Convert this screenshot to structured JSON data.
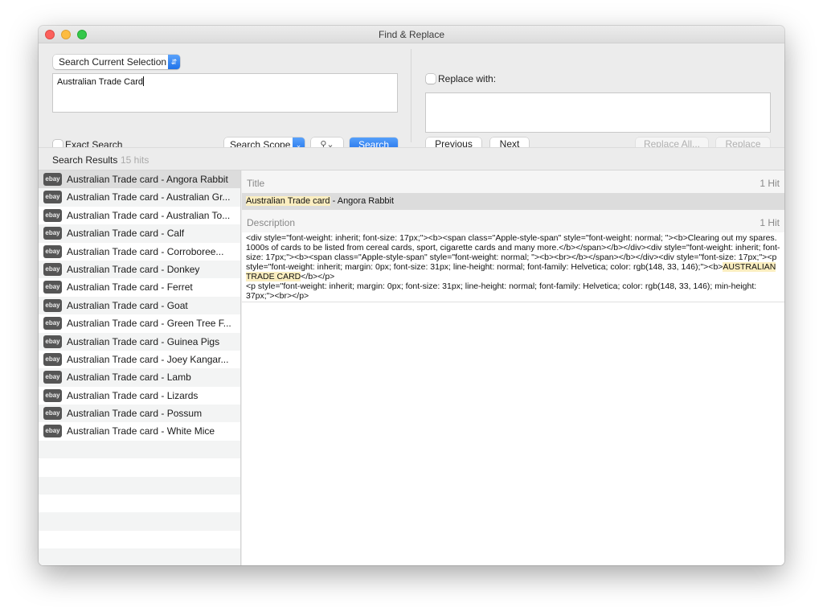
{
  "window": {
    "title": "Find & Replace"
  },
  "search": {
    "scope_select": "Search Current Selection",
    "query": "Australian Trade Card",
    "exact_search_label": "Exact Search",
    "exact_search_checked": false,
    "search_scope_label": "Search Scope",
    "search_options_icon": "magnifier-dropdown",
    "search_button": "Search"
  },
  "replace": {
    "checkbox_label": "Replace with:",
    "checked": false,
    "value": "",
    "previous_button": "Previous",
    "next_button": "Next",
    "replace_all_button": "Replace All...",
    "replace_button": "Replace"
  },
  "results": {
    "title": "Search Results",
    "count": "15 hits",
    "badge": "ebay",
    "items": [
      {
        "label": "Australian Trade card - Angora Rabbit"
      },
      {
        "label": "Australian Trade card - Australian Gr..."
      },
      {
        "label": "Australian Trade card - Australian To..."
      },
      {
        "label": "Australian Trade card - Calf"
      },
      {
        "label": "Australian Trade card - Corroboree..."
      },
      {
        "label": "Australian Trade card - Donkey"
      },
      {
        "label": "Australian Trade card - Ferret"
      },
      {
        "label": "Australian Trade card - Goat"
      },
      {
        "label": "Australian Trade card - Green Tree F..."
      },
      {
        "label": "Australian Trade card - Guinea Pigs"
      },
      {
        "label": "Australian Trade card - Joey Kangar..."
      },
      {
        "label": "Australian Trade card - Lamb"
      },
      {
        "label": "Australian Trade card - Lizards"
      },
      {
        "label": "Australian Trade card - Possum"
      },
      {
        "label": "Australian Trade card - White Mice"
      }
    ]
  },
  "detail": {
    "title_section": {
      "label": "Title",
      "hits": "1 Hit",
      "highlight": "Australian Trade card",
      "rest": " - Angora Rabbit"
    },
    "description_section": {
      "label": "Description",
      "hits": "1 Hit",
      "text_before": "<div style=\"font-weight: inherit; font-size: 17px;\"><b><span class=\"Apple-style-span\" style=\"font-weight: normal; \"><b>Clearing out my spares. 1000s of cards to be listed from cereal cards, sport, cigarette cards and many more.</b></span></b></div><div style=\"font-weight: inherit; font-size: 17px;\"><b><span class=\"Apple-style-span\" style=\"font-weight: normal; \"><b><br></b></span></b></div><div style=\"font-size: 17px;\"><p style=\"font-weight: inherit; margin: 0px; font-size: 31px; line-height: normal; font-family: Helvetica; color: rgb(148, 33, 146);\"><b>",
      "highlight": "AUSTRALIAN TRADE CARD",
      "text_after": "</b></p>",
      "text_line2": "<p style=\"font-weight: inherit; margin: 0px; font-size: 31px; line-height: normal; font-family: Helvetica; color: rgb(148, 33, 146); min-height: 37px;\"><br></p>"
    }
  },
  "colors": {
    "accent": "#1f72ea",
    "highlight": "#fbeec0",
    "selected_row": "#dcdcdc"
  }
}
